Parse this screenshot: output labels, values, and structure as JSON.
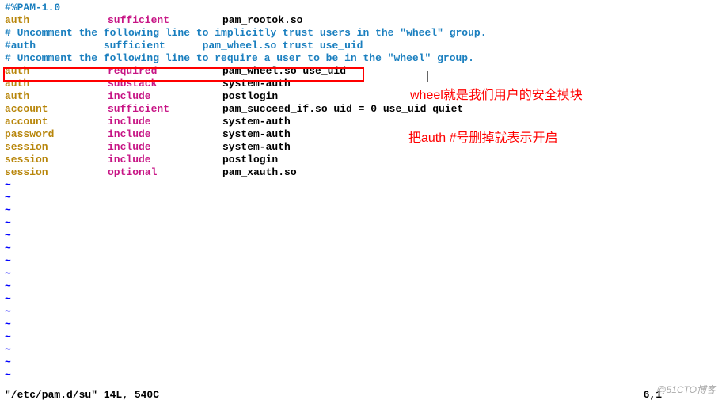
{
  "lines": [
    {
      "type": "comment",
      "text": "#%PAM-1.0"
    },
    {
      "type": "entry",
      "facility": "auth",
      "control": "sufficient",
      "module": "pam_rootok.so",
      "args": ""
    },
    {
      "type": "comment",
      "text": "# Uncomment the following line to implicitly trust users in the \"wheel\" group."
    },
    {
      "type": "comment",
      "text": "#auth           sufficient      pam_wheel.so trust use_uid"
    },
    {
      "type": "comment",
      "text": "# Uncomment the following line to require a user to be in the \"wheel\" group."
    },
    {
      "type": "entry",
      "facility": "auth",
      "control": "required",
      "module": "pam_wheel.so",
      "args": "use_uid"
    },
    {
      "type": "entry",
      "facility": "auth",
      "control": "substack",
      "module": "system-auth",
      "args": ""
    },
    {
      "type": "entry",
      "facility": "auth",
      "control": "include",
      "module": "postlogin",
      "args": ""
    },
    {
      "type": "entry",
      "facility": "account",
      "control": "sufficient",
      "module": "pam_succeed_if.so",
      "args": "uid = 0 use_uid quiet"
    },
    {
      "type": "entry",
      "facility": "account",
      "control": "include",
      "module": "system-auth",
      "args": ""
    },
    {
      "type": "entry",
      "facility": "password",
      "control": "include",
      "module": "system-auth",
      "args": ""
    },
    {
      "type": "entry",
      "facility": "session",
      "control": "include",
      "module": "system-auth",
      "args": ""
    },
    {
      "type": "entry",
      "facility": "session",
      "control": "include",
      "module": "postlogin",
      "args": ""
    },
    {
      "type": "entry",
      "facility": "session",
      "control": "optional",
      "module": "pam_xauth.so",
      "args": ""
    }
  ],
  "tilde": "~",
  "tilde_count": 16,
  "annotations": {
    "anno1": "wheel就是我们用户的安全模块",
    "anno2": "把auth #号删掉就表示开启"
  },
  "status": {
    "left": "\"/etc/pam.d/su\" 14L, 540C",
    "right": "6,1"
  },
  "watermark": "@51CTO博客"
}
